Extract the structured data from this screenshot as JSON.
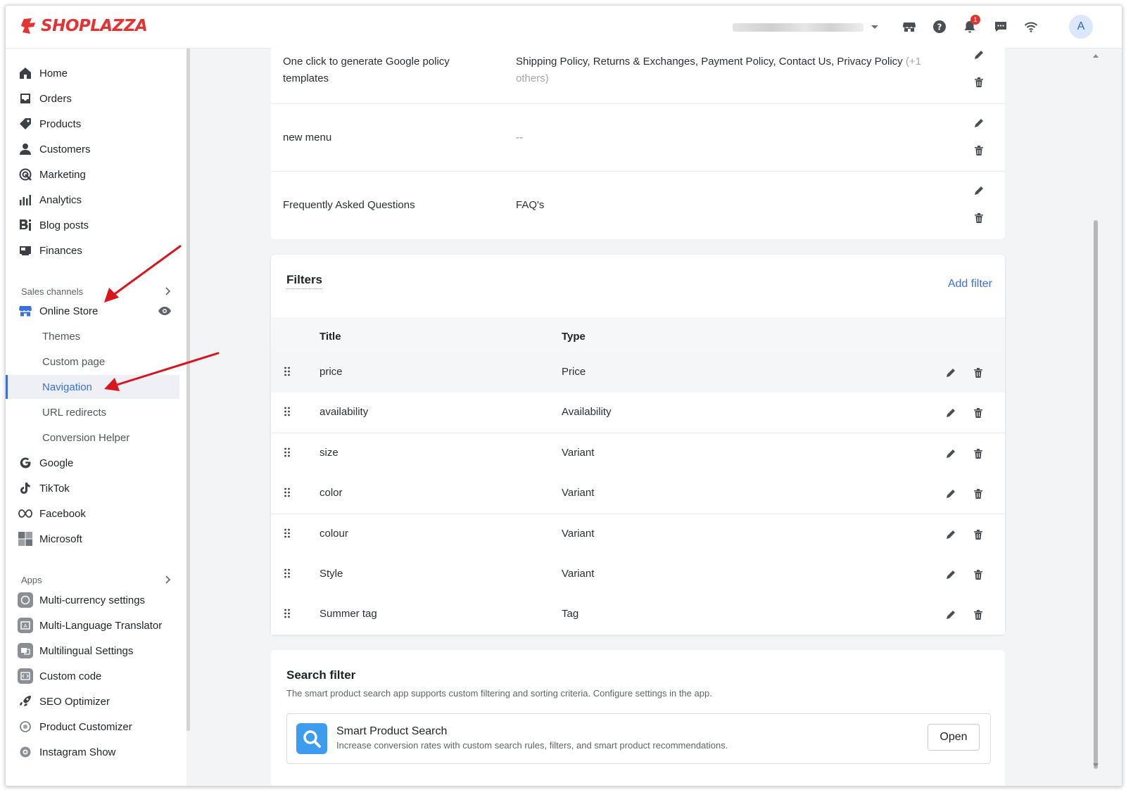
{
  "header": {
    "logo_text": "SHOPLAZZA",
    "notification_count": "1",
    "avatar_letter": "A"
  },
  "sidebar": {
    "main_items": [
      "Home",
      "Orders",
      "Products",
      "Customers",
      "Marketing",
      "Analytics",
      "Blog posts",
      "Finances"
    ],
    "sales_channels_label": "Sales channels",
    "online_store_label": "Online Store",
    "online_store_sub": [
      "Themes",
      "Custom page",
      "Navigation",
      "URL redirects",
      "Conversion Helper"
    ],
    "active_sub": "Navigation",
    "channels": [
      "Google",
      "TikTok",
      "Facebook",
      "Microsoft"
    ],
    "apps_label": "Apps",
    "apps": [
      "Multi-currency settings",
      "Multi-Language Translator",
      "Multilingual Settings",
      "Custom code",
      "SEO Optimizer",
      "Product Customizer",
      "Instagram Show"
    ]
  },
  "menus": {
    "rows": [
      {
        "title_line1": "One click to generate Google policy",
        "title_line2": "templates",
        "items": "Shipping Policy, Returns & Exchanges, Payment Policy, Contact Us, Privacy Policy",
        "more_line1": "(+1",
        "more_line2": "others)"
      },
      {
        "title": "new menu",
        "items": "--"
      },
      {
        "title": "Frequently Asked Questions",
        "items": "FAQ's"
      }
    ]
  },
  "filters": {
    "heading": "Filters",
    "add_label": "Add filter",
    "col_title": "Title",
    "col_type": "Type",
    "rows": [
      {
        "title": "price",
        "type": "Price"
      },
      {
        "title": "availability",
        "type": "Availability"
      },
      {
        "title": "size",
        "type": "Variant"
      },
      {
        "title": "color",
        "type": "Variant"
      },
      {
        "title": "colour",
        "type": "Variant"
      },
      {
        "title": "Style",
        "type": "Variant"
      },
      {
        "title": "Summer tag",
        "type": "Tag"
      }
    ]
  },
  "search_filter": {
    "heading": "Search filter",
    "description": "The smart product search app supports custom filtering and sorting criteria. Configure settings in the app.",
    "app_name": "Smart Product Search",
    "app_desc": "Increase conversion rates with custom search rules, filters, and smart product recommendations.",
    "open_label": "Open"
  },
  "colors": {
    "accent": "#3a6fe0",
    "brand": "#e53232",
    "annotation_arrow": "#d9141c"
  }
}
